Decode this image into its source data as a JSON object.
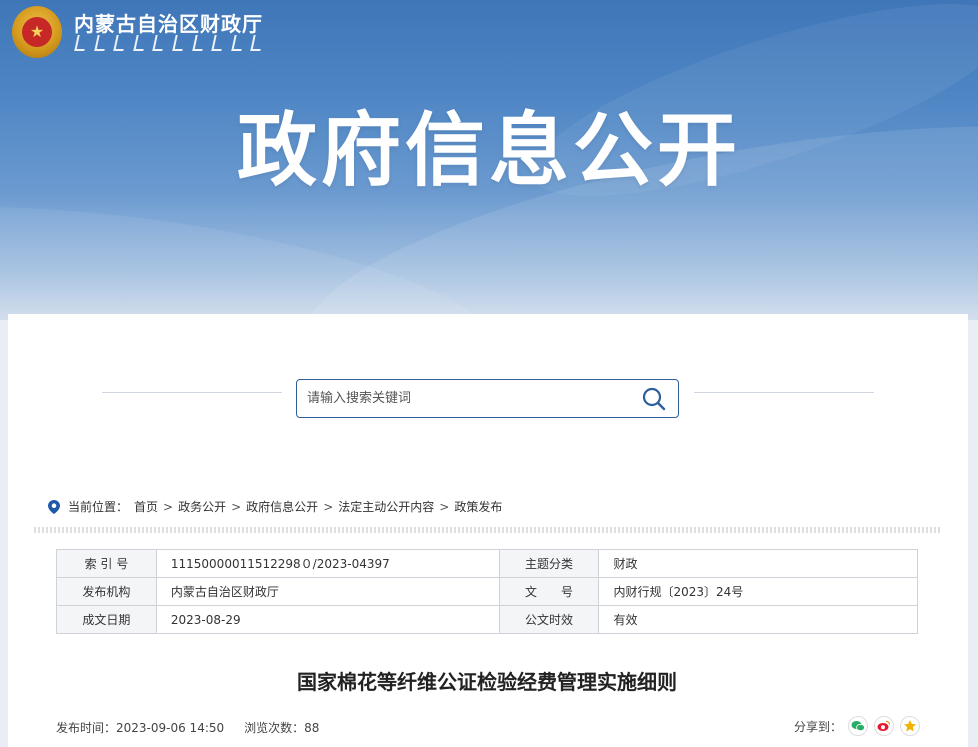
{
  "header": {
    "org_name": "内蒙古自治区财政厅",
    "hero_title": "政府信息公开"
  },
  "search": {
    "placeholder": "请输入搜索关键词"
  },
  "breadcrumb": {
    "label": "当前位置：",
    "items": [
      "首页",
      "政务公开",
      "政府信息公开",
      "法定主动公开内容",
      "政策发布"
    ],
    "separator": ">"
  },
  "meta_table": {
    "rows": [
      {
        "label1": "索 引 号",
        "value1": "11150000011512298０/2023-04397",
        "label2": "主题分类",
        "value2": "财政"
      },
      {
        "label1": "发布机构",
        "value1": "内蒙古自治区财政厅",
        "label2": "文　　号",
        "value2": "内财行规〔2023〕24号"
      },
      {
        "label1": "成文日期",
        "value1": "2023-08-29",
        "label2": "公文时效",
        "value2": "有效"
      }
    ]
  },
  "document": {
    "title": "国家棉花等纤维公证检验经费管理实施细则",
    "publish_label": "发布时间：2023-09-06 14:50",
    "views_label": "浏览次数：88",
    "share_label": "分享到："
  },
  "colors": {
    "accent": "#2e5e9e",
    "location_icon": "#1f5aa6",
    "wechat": "#2aae67",
    "weibo": "#e6162d",
    "favorite": "#f0b400"
  }
}
